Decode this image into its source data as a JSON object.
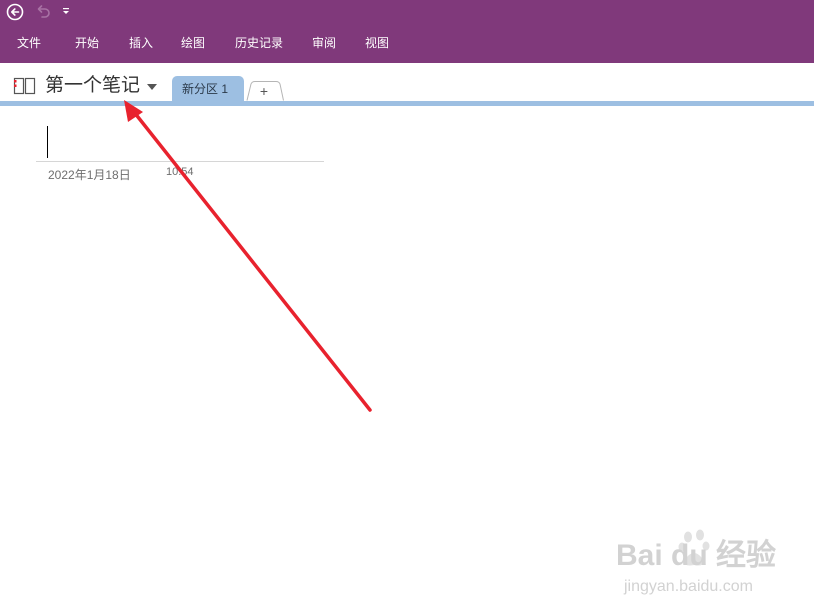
{
  "quick_access": {
    "back_icon": "back-circle-icon",
    "undo_icon": "undo-icon",
    "customize_icon": "customize-quick-access-icon"
  },
  "ribbon": {
    "tabs": [
      {
        "label": "文件"
      },
      {
        "label": "开始"
      },
      {
        "label": "插入"
      },
      {
        "label": "绘图"
      },
      {
        "label": "历史记录"
      },
      {
        "label": "审阅"
      },
      {
        "label": "视图"
      }
    ]
  },
  "notebook": {
    "name": "第一个笔记",
    "icon": "notebook-icon",
    "dropdown_icon": "chevron-down-icon",
    "sections": [
      {
        "label": "新分区 1",
        "active": true
      }
    ],
    "add_section_label": "+"
  },
  "page": {
    "date": "2022年1月18日",
    "time": "10:54"
  },
  "annotation": {
    "color": "#e8222e"
  },
  "watermark": {
    "brand": "Bai du 经验",
    "url": "jingyan.baidu.com"
  },
  "colors": {
    "ribbon_bg": "#80397b",
    "section_tab": "#9dbfe2",
    "arrow": "#e8222e"
  }
}
